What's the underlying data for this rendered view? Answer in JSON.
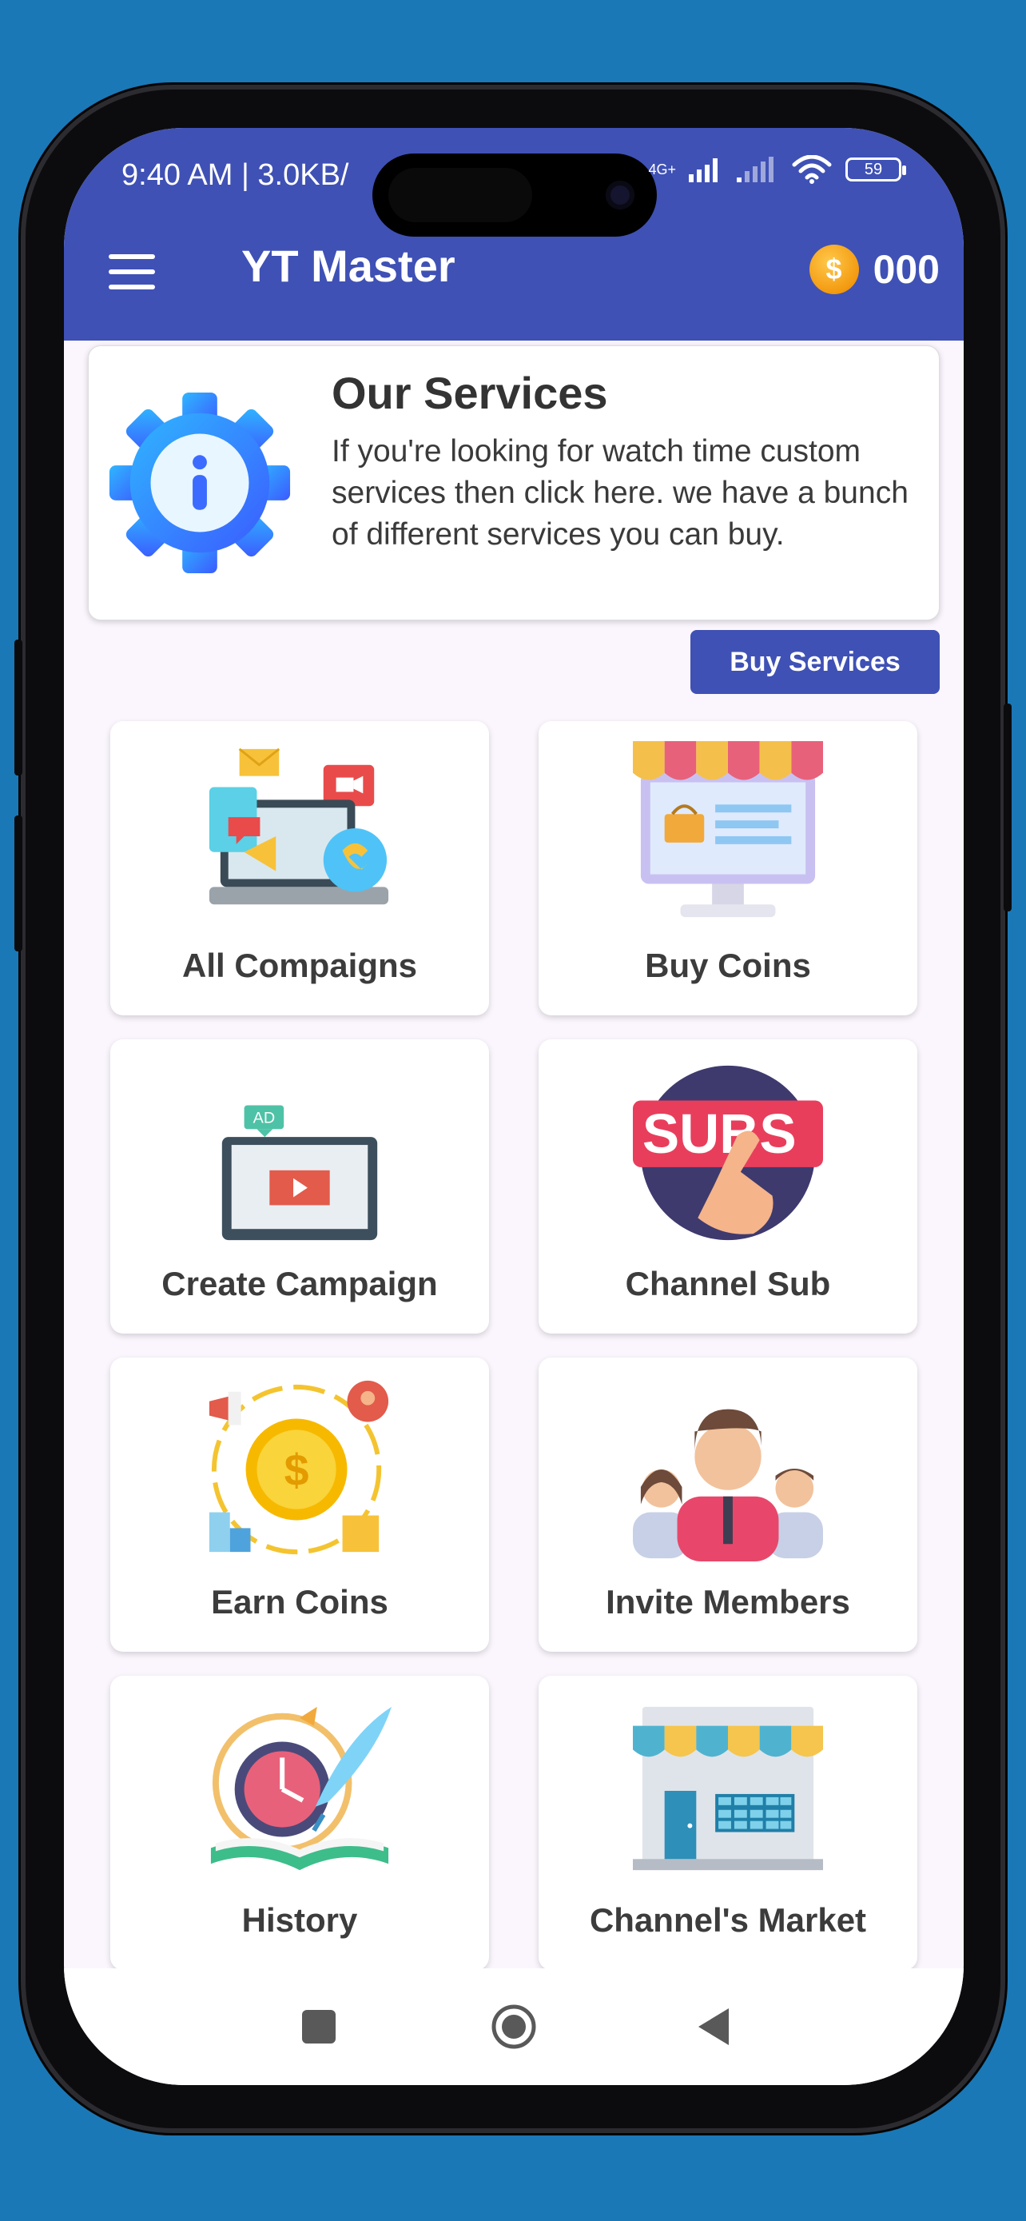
{
  "status_bar": {
    "time": "9:40 AM | 3.0KB/",
    "network": "4G+",
    "battery": "59"
  },
  "app_bar": {
    "title": "YT Master",
    "coins": "000",
    "menu_icon": "hamburger-menu-icon",
    "coin_icon": "dollar-coin-icon"
  },
  "services": {
    "title": "Our Services",
    "description": "If you're looking for watch time custom services then click here. we have a bunch of different services you can buy.",
    "icon": "info-gear-icon",
    "button_label": "Buy Services"
  },
  "tiles": [
    {
      "label": "All Compaigns",
      "icon": "campaigns-laptop-icon"
    },
    {
      "label": "Buy Coins",
      "icon": "online-shop-icon"
    },
    {
      "label": "Create Campaign",
      "icon": "ad-monitor-icon"
    },
    {
      "label": "Channel Sub",
      "icon": "subscribe-hand-icon"
    },
    {
      "label": "Earn Coins",
      "icon": "earn-coins-icon"
    },
    {
      "label": "Invite Members",
      "icon": "team-members-icon"
    },
    {
      "label": "History",
      "icon": "history-book-icon"
    },
    {
      "label": "Channel's Market",
      "icon": "market-store-icon"
    }
  ],
  "nav_bar": {
    "recents_icon": "recents-square-icon",
    "home_icon": "home-circle-icon",
    "back_icon": "back-triangle-icon"
  },
  "colors": {
    "primary": "#3f51b5",
    "background": "#fbf6fd",
    "outer_background": "#1b78b6",
    "coin": "#f39a10"
  }
}
